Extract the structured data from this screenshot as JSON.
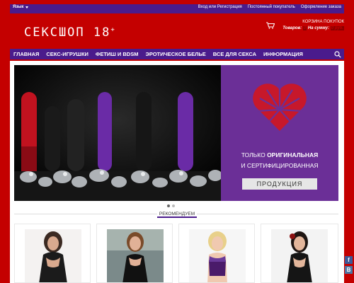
{
  "topbar": {
    "language": "Язык",
    "links": [
      "Вход или Регистрация",
      "Постоянный покупатель",
      "Оформление заказа"
    ]
  },
  "header": {
    "logo": "СЕКСШОП 18",
    "logo_plus": "+",
    "cart": {
      "title": "КОРЗИНА ПОКУПОК",
      "items_label": "Товаров:",
      "items_value": "0",
      "sum_label": "На сумму:",
      "sum_value": "0 руб."
    }
  },
  "nav": {
    "items": [
      "ГЛАВНАЯ",
      "СЕКС-ИГРУШКИ",
      "ФЕТИШ И BDSM",
      "ЭРОТИЧЕСКОЕ БЕЛЬЕ",
      "ВСЕ ДЛЯ СЕКСА",
      "ИНФОРМАЦИЯ"
    ]
  },
  "banner": {
    "line1_a": "ТОЛЬКО ",
    "line1_b": "ОРИГИНАЛЬНАЯ",
    "line2": "И СЕРТИФИЦИРОВАННАЯ",
    "badge": "ПРОДУКЦИЯ"
  },
  "section": {
    "title": "РЕКОМЕНДУЕМ"
  },
  "social": {
    "fb": "f",
    "vk": "B"
  },
  "colors": {
    "brand_red": "#c40000",
    "purple": "#4a1b8c",
    "banner_purple": "#6b2f97"
  }
}
